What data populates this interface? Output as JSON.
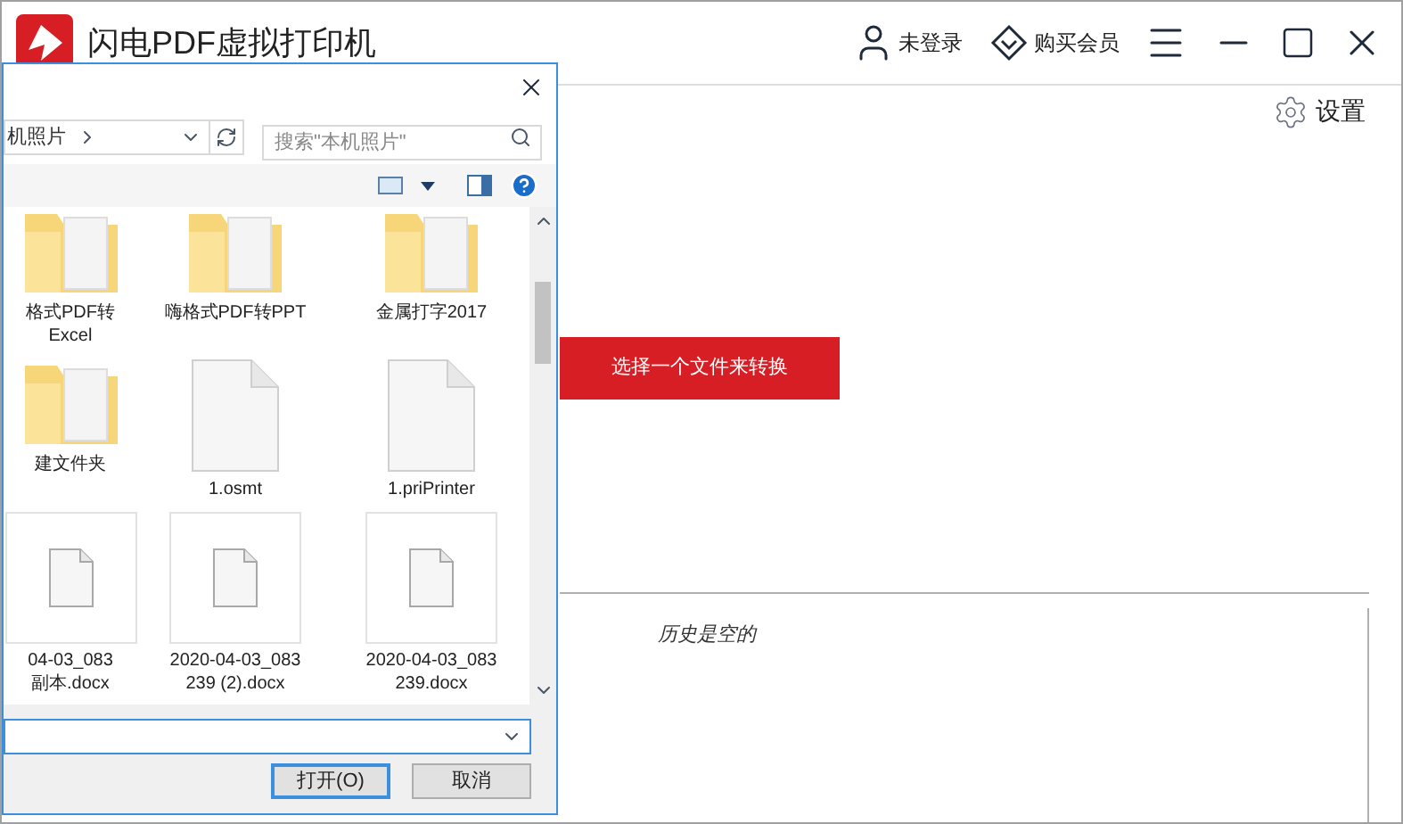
{
  "app": {
    "title": "闪电PDF虚拟打印机",
    "header_items": [
      {
        "kind": "user",
        "label": "未登录"
      },
      {
        "kind": "vip",
        "label": "购买会员"
      }
    ],
    "settings": "设置",
    "convert_button": "选择一个文件来转换",
    "history_empty": "历史是空的"
  },
  "dialog": {
    "address": "机照片",
    "search": {
      "placeholder": "搜索\"本机照片\""
    },
    "files": [
      {
        "kind": "folder",
        "lines": [
          "格式PDF转",
          "Excel"
        ]
      },
      {
        "kind": "folder",
        "lines": [
          "嗨格式PDF转PPT"
        ]
      },
      {
        "kind": "folder",
        "lines": [
          "金属打字2017"
        ]
      },
      {
        "kind": "folder",
        "lines": [
          "建文件夹"
        ]
      },
      {
        "kind": "file",
        "lines": [
          "1.osmt"
        ]
      },
      {
        "kind": "file",
        "lines": [
          "1.priPrinter"
        ]
      },
      {
        "kind": "doc",
        "lines": [
          "04-03_083",
          "副本.docx"
        ]
      },
      {
        "kind": "doc",
        "lines": [
          "2020-04-03_083",
          "239 (2).docx"
        ]
      },
      {
        "kind": "doc",
        "lines": [
          "2020-04-03_083",
          "239.docx"
        ]
      }
    ],
    "buttons": [
      {
        "label": "打开(O)",
        "default": true
      },
      {
        "label": "取消",
        "default": false
      }
    ]
  }
}
